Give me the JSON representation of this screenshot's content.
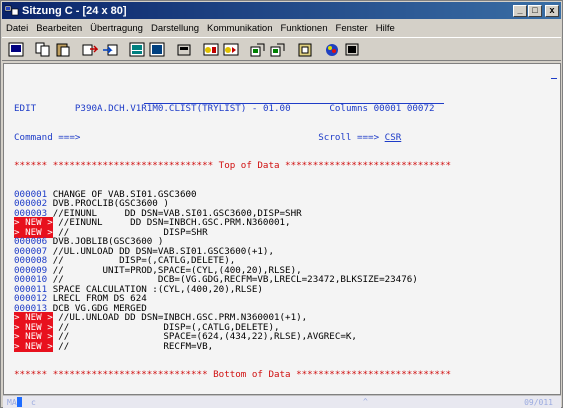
{
  "window": {
    "title": "Sitzung C - [24 x 80]",
    "min": "_",
    "max": "□",
    "close": "x"
  },
  "menu": [
    "Datei",
    "Bearbeiten",
    "Übertragung",
    "Darstellung",
    "Kommunikation",
    "Funktionen",
    "Fenster",
    "Hilfe"
  ],
  "toolbar": [
    "print-screen-icon",
    "copy-icon",
    "paste-icon",
    "send-file-icon",
    "receive-file-icon",
    "display-icon",
    "display-alt-icon",
    "macro-icon",
    "record-icon",
    "play-icon",
    "customize-icon",
    "customize-alt-icon",
    "clipboard-icon",
    "color-icon",
    "keypad-icon"
  ],
  "editor": {
    "header_mode": "EDIT",
    "header_file": "P390A.DCH.V1R1M0.CLIST(TRYLIST) - 01.00",
    "header_columns_label": "Columns",
    "header_col_from": "00001",
    "header_col_to": "00072",
    "command_label": "Command ===>",
    "scroll_label": "Scroll ===>",
    "scroll_value": "CSR",
    "top_line": "****** ***************************** Top of Data ******************************",
    "bottom_line": "****** **************************** Bottom of Data ****************************",
    "lines": [
      {
        "num": "000001",
        "new": "",
        "text": " CHANGE OF VAB.SI01.GSC3600"
      },
      {
        "num": "000002",
        "new": "",
        "text": " DVB.PROCLIB(GSC3600 )"
      },
      {
        "num": "000003",
        "new": "",
        "text": " //EINUNL     DD DSN=VAB.SI01.GSC3600,DISP=SHR"
      },
      {
        "num": "000004",
        "new": "> NEW >",
        "text": " //EINUNL     DD DSN=INBCH.GSC.PRM.N360001,"
      },
      {
        "num": "000005",
        "new": "> NEW >",
        "text": " //                 DISP=SHR"
      },
      {
        "num": "000006",
        "new": "",
        "text": " DVB.JOBLIB(GSC3600 )"
      },
      {
        "num": "000007",
        "new": "",
        "text": " //UL.UNLOAD DD DSN=VAB.SI01.GSC3600(+1),"
      },
      {
        "num": "000008",
        "new": "",
        "text": " //          DISP=(,CATLG,DELETE),"
      },
      {
        "num": "000009",
        "new": "",
        "text": " //       UNIT=PROD,SPACE=(CYL,(400,20),RLSE),"
      },
      {
        "num": "000010",
        "new": "",
        "text": " //                 DCB=(VG.GDG,RECFM=VB,LRECL=23472,BLKSIZE=23476)"
      },
      {
        "num": "000011",
        "new": "",
        "text": " SPACE CALCULATION :(CYL,(400,20),RLSE)"
      },
      {
        "num": "000012",
        "new": "",
        "text": " LRECL FROM DS 624"
      },
      {
        "num": "000013",
        "new": "",
        "text": " DCB VG.GDG MERGED"
      },
      {
        "num": "000014",
        "new": "> NEW >",
        "text": " //UL.UNLOAD DD DSN=INBCH.GSC.PRM.N360001(+1),"
      },
      {
        "num": "000015",
        "new": "> NEW >",
        "text": " //                 DISP=(,CATLG,DELETE),"
      },
      {
        "num": "000016",
        "new": "> NEW >",
        "text": " //                 SPACE=(624,(434,22),RLSE),AVGREC=K,"
      },
      {
        "num": "000017",
        "new": "> NEW >",
        "text": " //                 RECFM=VB,"
      }
    ]
  },
  "status": {
    "left": "MA",
    "mid": "c",
    "arrow": "^",
    "right": "09/011"
  }
}
